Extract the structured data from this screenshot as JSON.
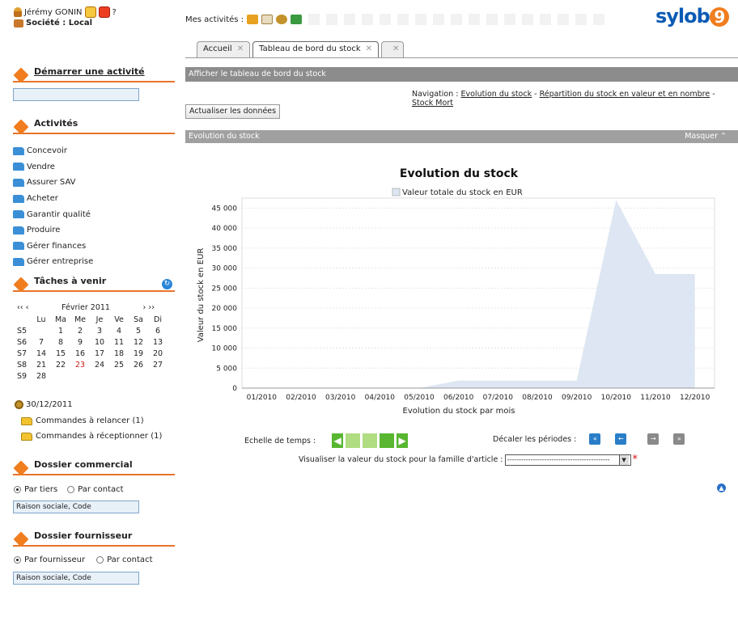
{
  "user": {
    "name": "Jérémy GONIN",
    "help": "?",
    "company": "Société : Local"
  },
  "sidebar": {
    "start": {
      "title": "Démarrer une activité",
      "value": ""
    },
    "activities": {
      "title": "Activités",
      "items": [
        "Concevoir",
        "Vendre",
        "Assurer SAV",
        "Acheter",
        "Garantir qualité",
        "Produire",
        "Gérer finances",
        "Gérer entreprise"
      ]
    },
    "tasks": {
      "title": "Tâches à venir",
      "nav_prev2": "‹‹",
      "nav_prev": "‹",
      "month": "Février 2011",
      "nav_next": "›",
      "nav_next2": "››",
      "headers": [
        "",
        "Lu",
        "Ma",
        "Me",
        "Je",
        "Ve",
        "Sa",
        "Di"
      ],
      "weeks": [
        [
          "S5",
          "",
          "1",
          "2",
          "3",
          "4",
          "5",
          "6"
        ],
        [
          "S6",
          "7",
          "8",
          "9",
          "10",
          "11",
          "12",
          "13"
        ],
        [
          "S7",
          "14",
          "15",
          "16",
          "17",
          "18",
          "19",
          "20"
        ],
        [
          "S8",
          "21",
          "22",
          "23",
          "24",
          "25",
          "26",
          "27"
        ],
        [
          "S9",
          "28",
          "",
          "",
          "",
          "",
          "",
          ""
        ]
      ],
      "today": "23",
      "date": "30/12/2011",
      "items": [
        "Commandes à relancer (1)",
        "Commandes à réceptionner (1)"
      ]
    },
    "commercial": {
      "title": "Dossier commercial",
      "radio1": "Par tiers",
      "radio2": "Par contact",
      "input": "Raison sociale, Code"
    },
    "supplier": {
      "title": "Dossier fournisseur",
      "radio1": "Par fournisseur",
      "radio2": "Par contact",
      "input": "Raison sociale, Code"
    }
  },
  "header": {
    "mes_activites": "Mes activités :",
    "logo": "sylob",
    "logo_num": "9"
  },
  "tabs": [
    {
      "label": "Accueil",
      "close": "✕"
    },
    {
      "label": "Tableau de bord du stock",
      "close": "✕"
    },
    {
      "label": "",
      "close": "✕"
    }
  ],
  "main": {
    "bar_title": "Afficher le tableau de bord du stock",
    "nav_label": "Navigation :",
    "nav_links": [
      "Evolution du stock",
      "Répartition du stock en valeur et en nombre",
      "Stock Mort"
    ],
    "nav_sep": "-",
    "refresh_button": "Actualiser les données",
    "section_title": "Evolution du stock",
    "hide_label": "Masquer",
    "scale_label": "Echelle de temps :",
    "period_label": "Décaler les périodes :",
    "family_label": "Visualiser la valeur du stock pour la famille d'article :",
    "family_value": "--------------------------------------------"
  },
  "chart_data": {
    "type": "area",
    "title": "Evolution du stock",
    "legend": [
      "Valeur totale du stock en EUR"
    ],
    "xlabel": "Evolution du stock par mois",
    "ylabel": "Valeur du stock en EUR",
    "ylim": [
      0,
      45000
    ],
    "yticks": [
      "0",
      "5 000",
      "10 000",
      "15 000",
      "20 000",
      "25 000",
      "30 000",
      "35 000",
      "40 000",
      "45 000"
    ],
    "categories": [
      "01/2010",
      "02/2010",
      "03/2010",
      "04/2010",
      "05/2010",
      "06/2010",
      "07/2010",
      "08/2010",
      "09/2010",
      "10/2010",
      "11/2010",
      "12/2010"
    ],
    "series": [
      {
        "name": "Valeur totale du stock en EUR",
        "values": [
          0,
          0,
          0,
          0,
          0,
          1900,
          1900,
          1900,
          1900,
          47000,
          28500,
          28500
        ]
      }
    ],
    "fill": "#dde6f2"
  }
}
